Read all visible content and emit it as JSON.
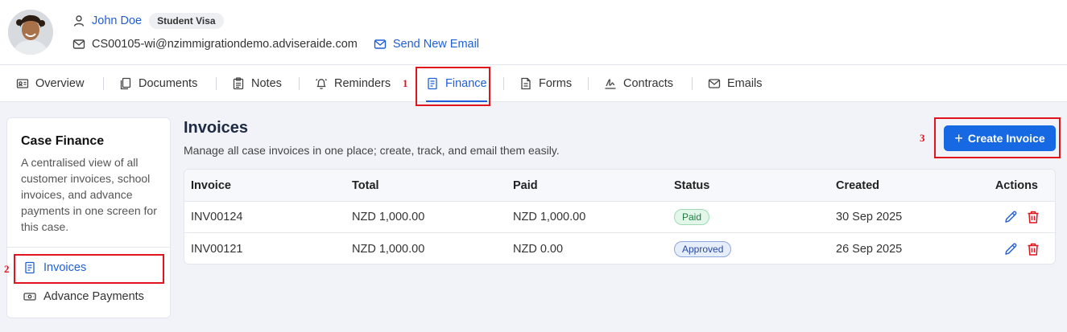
{
  "header": {
    "name": "John Doe",
    "visa_badge": "Student Visa",
    "email": "CS00105-wi@nzimmigrationdemo.adviseraide.com",
    "send_email_label": "Send New Email"
  },
  "tabs": [
    {
      "label": "Overview",
      "icon": "id-card-icon"
    },
    {
      "label": "Documents",
      "icon": "documents-icon"
    },
    {
      "label": "Notes",
      "icon": "clipboard-icon"
    },
    {
      "label": "Reminders",
      "icon": "bell-icon"
    },
    {
      "label": "Finance",
      "icon": "document-icon",
      "active": true
    },
    {
      "label": "Forms",
      "icon": "form-icon"
    },
    {
      "label": "Contracts",
      "icon": "signature-icon"
    },
    {
      "label": "Emails",
      "icon": "mail-icon"
    }
  ],
  "sidebar": {
    "title": "Case Finance",
    "description": "A centralised view of all customer invoices, school invoices, and advance payments in one screen for this case.",
    "items": [
      {
        "label": "Invoices",
        "icon": "document-icon",
        "active": true
      },
      {
        "label": "Advance Payments",
        "icon": "banknote-icon"
      }
    ]
  },
  "main": {
    "title": "Invoices",
    "subtitle": "Manage all case invoices in one place; create, track, and email them easily.",
    "create_button": "Create Invoice",
    "table": {
      "columns": [
        "Invoice",
        "Total",
        "Paid",
        "Status",
        "Created",
        "Actions"
      ],
      "rows": [
        {
          "invoice": "INV00124",
          "total": "NZD 1,000.00",
          "paid": "NZD 1,000.00",
          "status": "Paid",
          "created": "30 Sep 2025"
        },
        {
          "invoice": "INV00121",
          "total": "NZD 1,000.00",
          "paid": "NZD 0.00",
          "status": "Approved",
          "created": "26 Sep 2025"
        }
      ]
    }
  },
  "annotations": {
    "one": "1",
    "two": "2",
    "three": "3"
  },
  "colors": {
    "accent": "#1668e3",
    "link": "#1f5fd6",
    "annotation": "#e0141c",
    "delete": "#e0141c"
  }
}
